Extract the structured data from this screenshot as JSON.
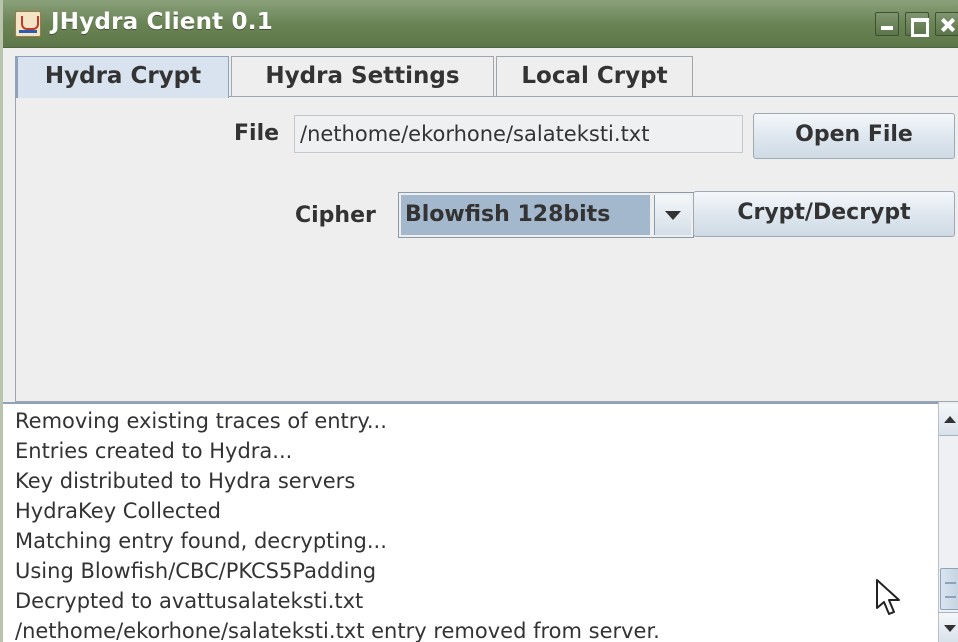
{
  "window": {
    "title": "JHydra Client 0.1"
  },
  "tabs": [
    {
      "label": "Hydra Crypt",
      "active": true
    },
    {
      "label": "Hydra Settings",
      "active": false
    },
    {
      "label": "Local Crypt",
      "active": false
    }
  ],
  "form": {
    "file_label": "File",
    "file_value": "/nethome/ekorhone/salateksti.txt",
    "open_file_button": "Open File",
    "cipher_label": "Cipher",
    "cipher_selected": "Blowfish 128bits",
    "crypt_button": "Crypt/Decrypt"
  },
  "log": {
    "lines": [
      "Removing existing traces of entry...",
      "Entries created to Hydra...",
      "Key distributed to Hydra servers",
      "HydraKey Collected",
      "Matching entry found, decrypting...",
      "Using Blowfish/CBC/PKCS5Padding",
      "Decrypted to avattusalateksti.txt",
      "/nethome/ekorhone/salateksti.txt entry removed from server."
    ]
  },
  "colors": {
    "titlebar": "#6a8456",
    "selection": "#a3b8cc",
    "panel": "#eeeeee"
  },
  "icons": {
    "app": "java-cup-icon",
    "minimize": "minimize-icon",
    "maximize": "maximize-icon",
    "close": "close-icon",
    "dropdown": "chevron-down-icon",
    "pointer": "mouse-pointer-icon"
  }
}
